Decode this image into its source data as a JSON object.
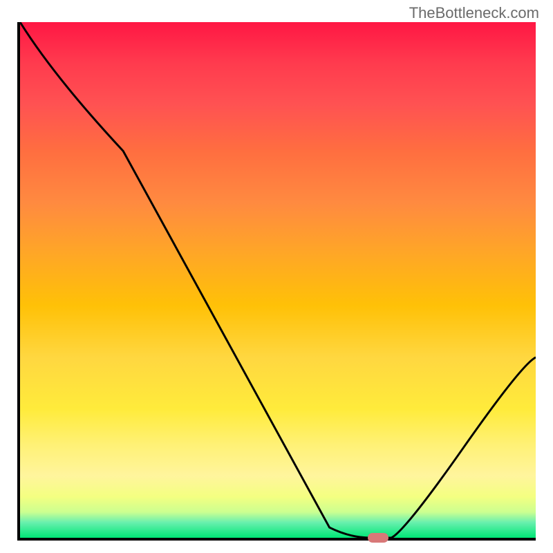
{
  "watermark": "TheBottleneck.com",
  "chart_data": {
    "type": "line",
    "title": "",
    "xlabel": "",
    "ylabel": "",
    "xlim": [
      0,
      100
    ],
    "ylim": [
      0,
      100
    ],
    "curve_points": [
      {
        "x": 0,
        "y": 100
      },
      {
        "x": 20,
        "y": 75
      },
      {
        "x": 60,
        "y": 2
      },
      {
        "x": 68,
        "y": 0
      },
      {
        "x": 72,
        "y": 0
      },
      {
        "x": 100,
        "y": 35
      }
    ],
    "marker": {
      "x": 69,
      "y": 0.5,
      "color": "#d87878"
    },
    "gradient": {
      "type": "vertical",
      "stops": [
        {
          "pos": 0,
          "color": "#ff1744"
        },
        {
          "pos": 50,
          "color": "#ffc107"
        },
        {
          "pos": 75,
          "color": "#ffeb3b"
        },
        {
          "pos": 100,
          "color": "#00e676"
        }
      ]
    }
  }
}
